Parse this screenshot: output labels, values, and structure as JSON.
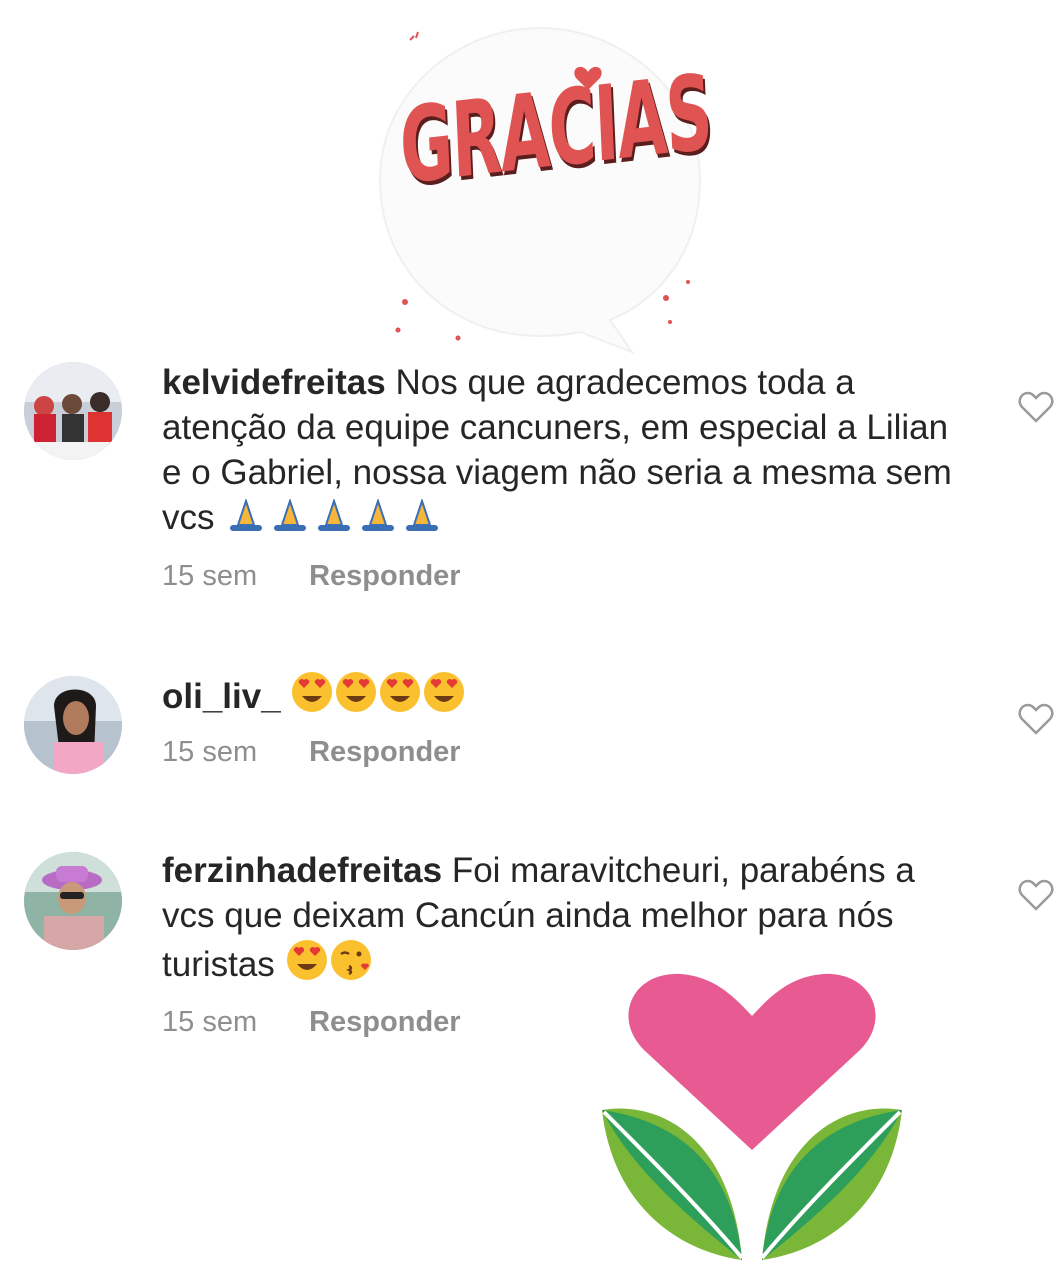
{
  "sticker": {
    "text": "GRACIAS"
  },
  "reply_label": "Responder",
  "comments": [
    {
      "username": "kelvidefreitas",
      "text": "Nos que agradecemos toda a atenção da equipe cancuners, em especial a Lilian e o Gabriel, nossa viagem não seria a mesma sem vcs",
      "emoji_icon": "folded-hands",
      "emoji_count": 5,
      "time": "15 sem"
    },
    {
      "username": "oli_liv_",
      "text": "",
      "emoji_icon": "heart-eyes",
      "emoji_count": 4,
      "time": "15 sem"
    },
    {
      "username": "ferzinhadefreitas",
      "text": "Foi maravitcheuri, parabéns a vcs que deixam Cancún ainda melhor para nós turistas",
      "emoji_icon": "heart-eyes-kiss",
      "emoji_count": 2,
      "time": "15 sem"
    }
  ],
  "colors": {
    "text": "#262626",
    "meta": "#8e8e8e",
    "gracias_red": "#e05353",
    "heart_pink": "#e85a92",
    "leaf_green": "#7ab638",
    "leaf_dark_green": "#2e9e5b"
  }
}
